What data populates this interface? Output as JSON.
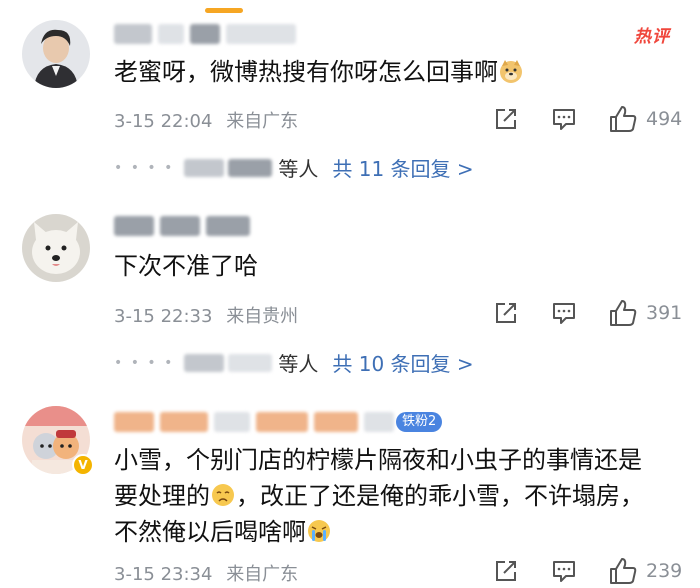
{
  "hot_tag": "热评",
  "colors": {
    "link": "#3e6fb5",
    "meta": "#8a8f96",
    "hot": "#f0463c",
    "fan_badge": "#4a84e0",
    "accent": "#f6a623"
  },
  "comments": [
    {
      "text": "老蜜呀，微博热搜有你呀怎么回事啊",
      "emoji": "doge-emoji",
      "date": "3-15 22:04",
      "location": "来自广东",
      "likes": "494",
      "replies_who": "等人",
      "replies_more": "共 11 条回复 >"
    },
    {
      "text": "下次不准了哈",
      "date": "3-15 22:33",
      "location": "来自贵州",
      "likes": "391",
      "replies_who": "等人",
      "replies_more": "共 10 条回复 >"
    },
    {
      "fan_badge": "铁粉2",
      "verified": "V",
      "text_line1": "小雪，个别门店的柠檬片隔夜和小虫子的事情还是",
      "text_line2a": "要处理的",
      "text_line2b": "，改正了还是俺的乖小雪，不许塌房，",
      "text_line3": "不然俺以后喝啥啊",
      "date": "3-15 23:34",
      "location": "来自广东",
      "likes": "239"
    }
  ]
}
